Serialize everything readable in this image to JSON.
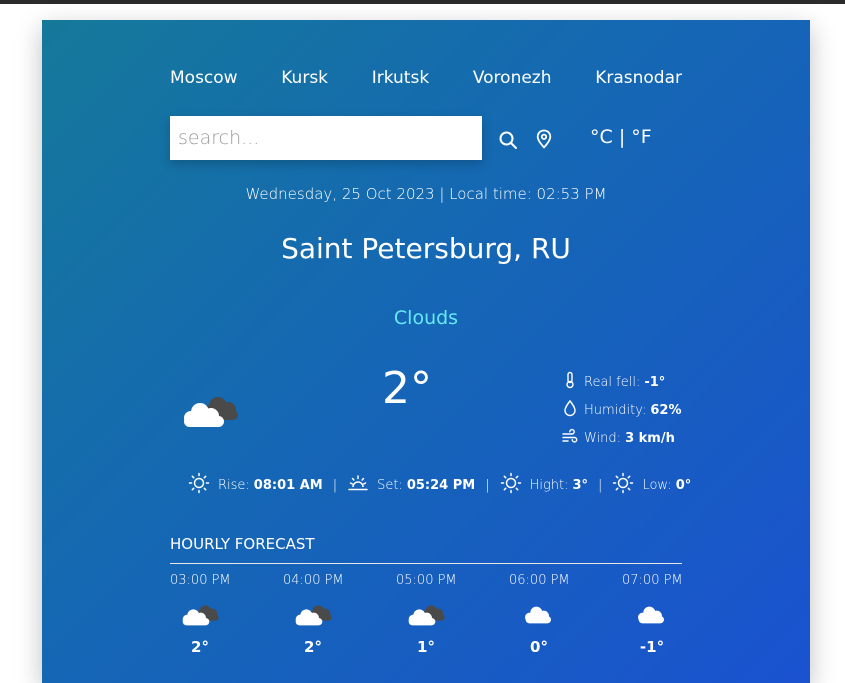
{
  "cities": [
    "Moscow",
    "Kursk",
    "Irkutsk",
    "Voronezh",
    "Krasnodar"
  ],
  "search": {
    "placeholder": "search...",
    "value": ""
  },
  "units": {
    "celsius": "°C",
    "separator": "|",
    "fahrenheit": "°F"
  },
  "datetime": "Wednesday, 25 Oct 2023 | Local time: 02:53 PM",
  "location": "Saint Petersburg, RU",
  "condition": "Clouds",
  "temperature": "2°",
  "details": {
    "feels_label": "Real fell:",
    "feels_value": "-1°",
    "humidity_label": "Humidity:",
    "humidity_value": "62%",
    "wind_label": "Wind:",
    "wind_value": "3 km/h"
  },
  "sun": {
    "rise_label": "Rise:",
    "rise_value": "08:01 AM",
    "set_label": "Set:",
    "set_value": "05:24 PM",
    "high_label": "Hight:",
    "high_value": "3°",
    "low_label": "Low:",
    "low_value": "0°",
    "separator": "|"
  },
  "hourly": {
    "title": "HOURLY FORECAST",
    "items": [
      {
        "time": "03:00 PM",
        "icon": "broken-clouds-icon",
        "temp": "2°"
      },
      {
        "time": "04:00 PM",
        "icon": "broken-clouds-icon",
        "temp": "2°"
      },
      {
        "time": "05:00 PM",
        "icon": "broken-clouds-icon",
        "temp": "1°"
      },
      {
        "time": "06:00 PM",
        "icon": "cloud-icon",
        "temp": "0°"
      },
      {
        "time": "07:00 PM",
        "icon": "cloud-icon",
        "temp": "-1°"
      }
    ]
  },
  "icons": {
    "search": "search-icon",
    "location": "location-pin-icon",
    "main": "broken-clouds-icon",
    "feels": "thermometer-icon",
    "humidity": "droplet-icon",
    "wind": "wind-icon",
    "rise": "sun-icon",
    "set": "sunset-icon",
    "high": "sun-icon",
    "low": "sun-icon"
  },
  "colors": {
    "gradient_start": "#15799a",
    "gradient_end": "#1a52d0",
    "condition": "#67e8f9"
  }
}
